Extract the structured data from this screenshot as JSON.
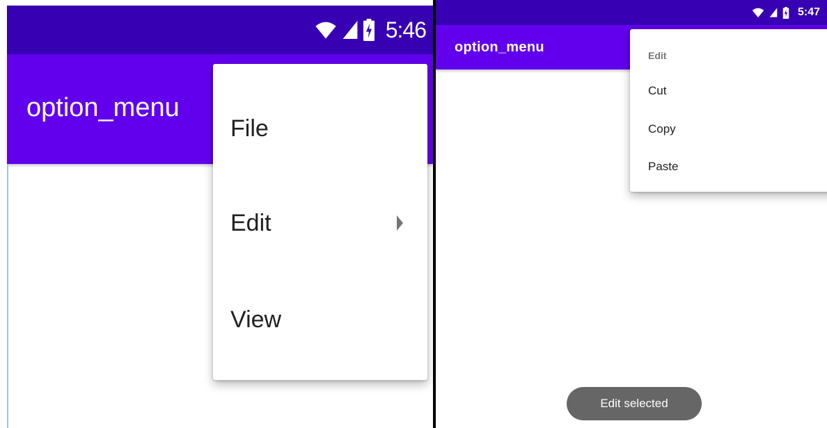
{
  "left_screen": {
    "status_bar": {
      "time": "5:46"
    },
    "app_bar": {
      "title": "option_menu"
    },
    "menu": {
      "items": [
        {
          "label": "File",
          "has_submenu": false
        },
        {
          "label": "Edit",
          "has_submenu": true
        },
        {
          "label": "View",
          "has_submenu": false
        }
      ]
    }
  },
  "right_screen": {
    "status_bar": {
      "time": "5:47"
    },
    "app_bar": {
      "title": "option_menu"
    },
    "submenu": {
      "header": "Edit",
      "items": [
        {
          "label": "Cut"
        },
        {
          "label": "Copy"
        },
        {
          "label": "Paste"
        }
      ]
    },
    "toast": {
      "text": "Edit selected"
    }
  },
  "icons": [
    "wifi-icon",
    "cell-signal-icon",
    "battery-charging-icon",
    "submenu-arrow-icon"
  ],
  "colors": {
    "status_bar": "#3700b3",
    "app_bar": "#6200ee",
    "menu_text": "#212121",
    "secondary_text": "#757575",
    "toast": "#666666"
  }
}
